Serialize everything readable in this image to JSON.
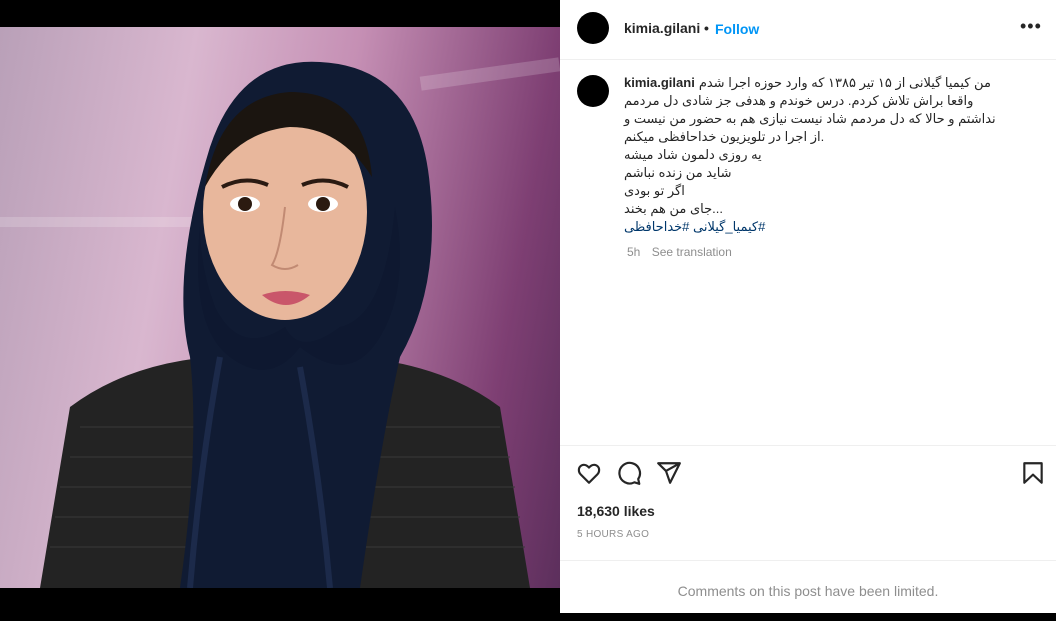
{
  "post_header": {
    "username": "kimia.gilani",
    "separator": "•",
    "follow_label": "Follow",
    "more_label": "•••"
  },
  "caption": {
    "username": "kimia.gilani",
    "lines": [
      "من کیمیا گیلانی از ۱۵ تیر ۱۳۸۵ که وارد حوزه اجرا شدم",
      "واقعا براش تلاش کردم. درس خوندم و هدفی جز شادی دل مردمم",
      "نداشتم و حالا که دل مردمم شاد نیست نیازی هم به حضور من نیست و",
      ".از اجرا در تلویزیون خداحافظی میکنم",
      "یه روزی دلمون شاد میشه",
      "شاید من زنده نباشم",
      "اگر تو بودی",
      "...جای من هم بخند"
    ],
    "hashtags": "#کیمیا_گیلانی #خداحافظی",
    "time": "5h",
    "see_translation": "See translation"
  },
  "actions": {
    "like_icon": "heart-icon",
    "comment_icon": "comment-icon",
    "share_icon": "share-icon",
    "save_icon": "bookmark-icon"
  },
  "likes": "18,630 likes",
  "posted_ago": "5 HOURS AGO",
  "comments_limited": "Comments on this post have been limited."
}
